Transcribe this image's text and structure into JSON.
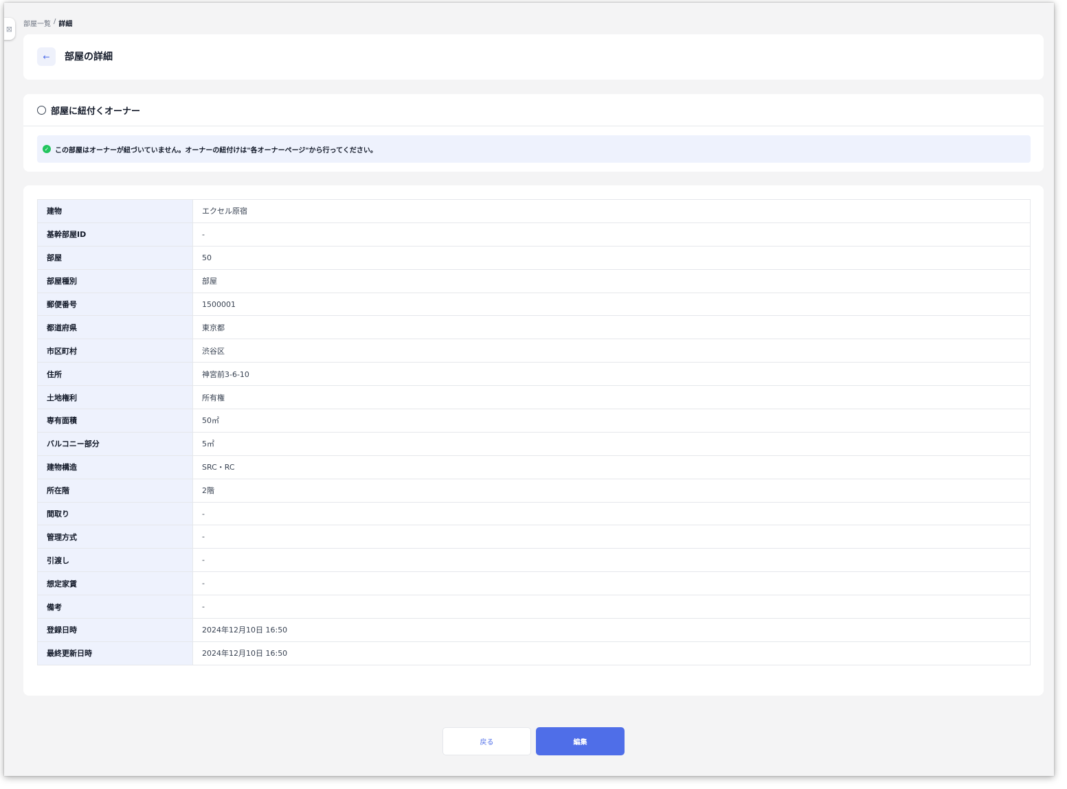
{
  "breadcrumb": {
    "parent": "部屋一覧",
    "separator": "/",
    "current": "詳細"
  },
  "header": {
    "back_icon": "←",
    "title": "部屋の詳細"
  },
  "owner_section": {
    "title": "部屋に紐付くオーナー",
    "message": "この部屋はオーナーが紐づいていません。オーナーの紐付けは\"各オーナーページ\"から行ってください。",
    "check_icon": "✓"
  },
  "details": [
    {
      "label": "建物",
      "value": "エクセル原宿"
    },
    {
      "label": "基幹部屋ID",
      "value": "-"
    },
    {
      "label": "部屋",
      "value": "50"
    },
    {
      "label": "部屋種別",
      "value": "部屋"
    },
    {
      "label": "郵便番号",
      "value": "1500001"
    },
    {
      "label": "都道府県",
      "value": "東京都"
    },
    {
      "label": "市区町村",
      "value": "渋谷区"
    },
    {
      "label": "住所",
      "value": "神宮前3-6-10"
    },
    {
      "label": "土地権利",
      "value": "所有権"
    },
    {
      "label": "専有面積",
      "value": "50㎡"
    },
    {
      "label": "バルコニー部分",
      "value": "5㎡"
    },
    {
      "label": "建物構造",
      "value": "SRC・RC"
    },
    {
      "label": "所在階",
      "value": "2階"
    },
    {
      "label": "間取り",
      "value": "-"
    },
    {
      "label": "管理方式",
      "value": "-"
    },
    {
      "label": "引渡し",
      "value": "-"
    },
    {
      "label": "想定家賃",
      "value": "-"
    },
    {
      "label": "備考",
      "value": "-"
    },
    {
      "label": "登録日時",
      "value": "2024年12月10日 16:50"
    },
    {
      "label": "最終更新日時",
      "value": "2024年12月10日 16:50"
    }
  ],
  "actions": {
    "back_label": "戻る",
    "edit_label": "編集"
  },
  "colors": {
    "accent": "#4f6ee8",
    "label_bg": "#eef2fd",
    "success": "#22c55e"
  }
}
